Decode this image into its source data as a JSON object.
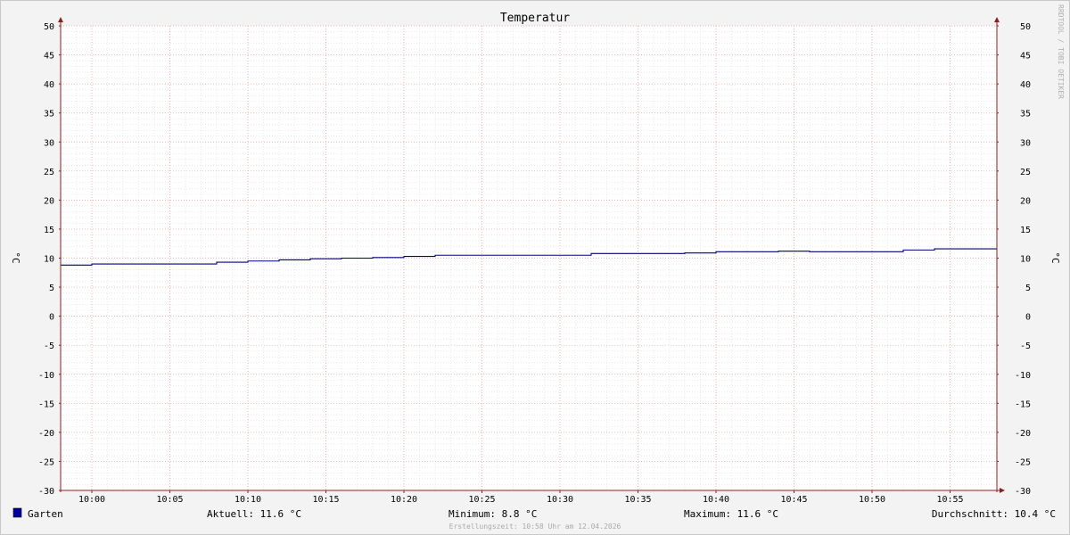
{
  "colors": {
    "background": "#f3f3f3",
    "canvas": "#ffffff",
    "minor_grid": "#dddddd",
    "major_grid": "#e6a0a0",
    "axis": "#8a2020",
    "series": "#000080",
    "legend_swatch": "#0000a0"
  },
  "watermark": "RRDTOOL / TOBI OETIKER",
  "footer": "Erstellungszeit: 10:58 Uhr am 12.04.2026",
  "legend": {
    "series_name": "Garten",
    "current": "Aktuell: 11.6 °C",
    "minimum": "Minimum: 8.8 °C",
    "maximum": "Maximum: 11.6 °C",
    "average": "Durchschnitt: 10.4 °C"
  },
  "chart_data": {
    "type": "line",
    "title": "Temperatur",
    "ylabel": "°C",
    "ylabel_right": "°C",
    "xlabel": "",
    "ylim": [
      -30,
      50
    ],
    "y_ticks": [
      50,
      45,
      40,
      35,
      30,
      25,
      20,
      15,
      10,
      5,
      0,
      -5,
      -10,
      -15,
      -20,
      -25,
      -30
    ],
    "y_tick_labels": [
      "50",
      "45",
      "40",
      "35",
      "30",
      "25",
      "20",
      "15",
      "10",
      "5",
      "0",
      "-5",
      "-10",
      "-15",
      "-20",
      "-25",
      "-30"
    ],
    "xlim": [
      "09:58",
      "10:58"
    ],
    "x_ticks": [
      "10:00",
      "10:05",
      "10:10",
      "10:15",
      "10:20",
      "10:25",
      "10:30",
      "10:35",
      "10:40",
      "10:45",
      "10:50",
      "10:55"
    ],
    "grid": true,
    "series": [
      {
        "name": "Garten",
        "step": true,
        "x": [
          "09:58",
          "10:00",
          "10:08",
          "10:10",
          "10:12",
          "10:14",
          "10:16",
          "10:18",
          "10:20",
          "10:22",
          "10:32",
          "10:38",
          "10:40",
          "10:44",
          "10:46",
          "10:52",
          "10:54",
          "10:58"
        ],
        "y": [
          8.8,
          9.0,
          9.3,
          9.5,
          9.7,
          9.9,
          10.0,
          10.1,
          10.3,
          10.5,
          10.8,
          10.9,
          11.1,
          11.2,
          11.1,
          11.4,
          11.6,
          11.6
        ]
      }
    ]
  }
}
